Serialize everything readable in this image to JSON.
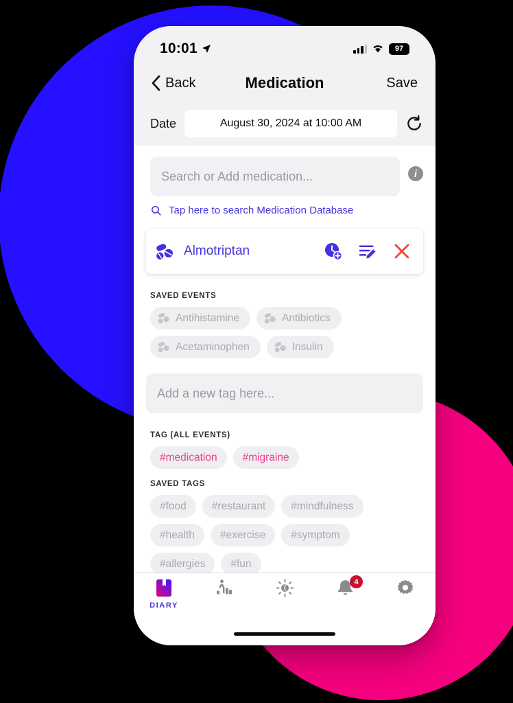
{
  "background": {
    "blue": "#2510FF",
    "pink": "#F5007E"
  },
  "status_bar": {
    "time": "10:01",
    "location_icon": "location-arrow-icon",
    "signal_icon": "cellular-signal-icon",
    "wifi_icon": "wifi-icon",
    "battery_level": "97"
  },
  "nav": {
    "back_label": "Back",
    "back_icon": "chevron-left-icon",
    "title": "Medication",
    "save_label": "Save"
  },
  "date_row": {
    "label": "Date",
    "value": "August 30, 2024 at 10:00 AM",
    "refresh_icon": "refresh-icon"
  },
  "search": {
    "placeholder": "Search or Add medication...",
    "info_icon": "info-icon",
    "database_link": "Tap here to search Medication Database",
    "search_icon": "search-icon",
    "link_color": "#4433DD"
  },
  "medication_card": {
    "pill_icon": "pills-icon",
    "name": "Almotriptan",
    "name_color": "#4433DD",
    "actions": [
      {
        "icon": "clock-add-icon",
        "color": "#4433DD"
      },
      {
        "icon": "note-edit-icon",
        "color": "#4433DD"
      },
      {
        "icon": "close-x-icon",
        "color": "#F04438"
      }
    ]
  },
  "saved_events": {
    "heading": "SAVED EVENTS",
    "items": [
      {
        "icon": "pills-icon",
        "label": "Antihistamine"
      },
      {
        "icon": "pills-icon",
        "label": "Antibiotics"
      },
      {
        "icon": "pills-icon",
        "label": "Acetaminophen"
      },
      {
        "icon": "pills-icon",
        "label": "Insulin"
      }
    ]
  },
  "tag_input": {
    "placeholder": "Add a new tag here..."
  },
  "tag_all_events": {
    "heading": "TAG (ALL EVENTS)",
    "color": "#EE3D8E",
    "items": [
      "#medication",
      "#migraine"
    ]
  },
  "saved_tags": {
    "heading": "SAVED TAGS",
    "items": [
      "#food",
      "#restaurant",
      "#mindfulness",
      "#health"
    ],
    "clipped_items": [
      "#exercise",
      "#symptom",
      "#allergies",
      "#fun"
    ]
  },
  "tab_bar": {
    "items": [
      {
        "icon": "diary-book-icon",
        "label": "DIARY",
        "active": true,
        "badge": ""
      },
      {
        "icon": "activity-chart-icon",
        "label": "",
        "active": false,
        "badge": ""
      },
      {
        "icon": "weather-sun-icon",
        "label": "",
        "active": false,
        "badge": ""
      },
      {
        "icon": "bell-icon",
        "label": "",
        "active": false,
        "badge": "4"
      },
      {
        "icon": "gear-icon",
        "label": "",
        "active": false,
        "badge": ""
      }
    ],
    "badge_color": "#C8102E",
    "active_color": "#4433DD"
  }
}
